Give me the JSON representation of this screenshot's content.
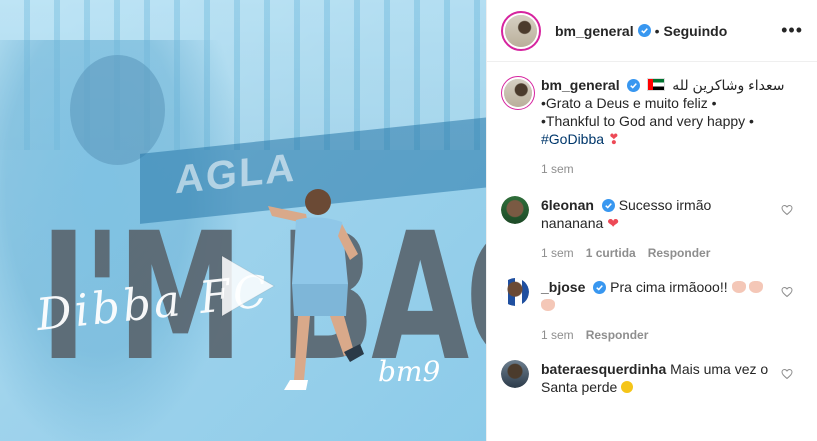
{
  "post": {
    "media": {
      "big_text": "I'M BACK",
      "script_text": "Dibba FC",
      "signature_mark": "bm9",
      "ad_text": "AGLA"
    },
    "header": {
      "username": "bm_general",
      "dot": "•",
      "follow_status": "Seguindo",
      "more_label": "•••"
    },
    "caption": {
      "username": "bm_general",
      "arabic": "سعداء وشاكرين لله",
      "line1": "•Grato a Deus e muito feliz •",
      "line2": "•Thankful to God and very happy •",
      "hashtag": "#GoDibba",
      "time": "1 sem"
    },
    "comments": [
      {
        "username": "6leonan",
        "text": "Sucesso irmão nananana",
        "emoji": "❤",
        "time": "1 sem",
        "likes": "1 curtida",
        "reply": "Responder",
        "verified": true
      },
      {
        "username": "_bjose",
        "text": "Pra cima irmãooo!!",
        "time": "1 sem",
        "reply": "Responder",
        "verified": true
      },
      {
        "username": "bateraesquerdinha",
        "text": "Mais uma vez o Santa perde",
        "verified": false
      }
    ]
  },
  "colors": {
    "verified_blue": "#3897f0",
    "link_blue": "#00376b",
    "muted": "#8e8e8e",
    "heart_red": "#ed4956"
  }
}
